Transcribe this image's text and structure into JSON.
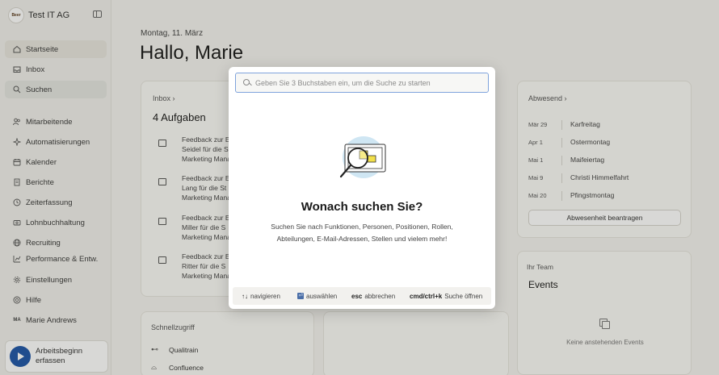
{
  "brand": {
    "name": "Test IT AG",
    "logo_text": "Beer"
  },
  "sidebar": {
    "items": [
      {
        "label": "Startseite"
      },
      {
        "label": "Inbox"
      },
      {
        "label": "Suchen"
      },
      {
        "label": "Mitarbeitende"
      },
      {
        "label": "Automatisierungen"
      },
      {
        "label": "Kalender"
      },
      {
        "label": "Berichte"
      },
      {
        "label": "Zeiterfassung"
      },
      {
        "label": "Lohnbuchhaltung"
      },
      {
        "label": "Recruiting"
      },
      {
        "label": "Performance & Entw."
      },
      {
        "label": "Einstellungen"
      },
      {
        "label": "Hilfe"
      },
      {
        "label": "Marie Andrews",
        "initials": "MA"
      }
    ],
    "cta_line1": "Arbeitsbeginn",
    "cta_line2": "erfassen"
  },
  "main": {
    "date": "Montag, 11. März",
    "greeting": "Hallo, Marie",
    "inbox": {
      "heading": "Inbox  ›",
      "count": "4 Aufgaben",
      "tasks": [
        {
          "l1": "Feedback zur E",
          "l2": "Seidel für die S",
          "l3": "Marketing Mana"
        },
        {
          "l1": "Feedback zur E",
          "l2": "Lang für die St",
          "l3": "Marketing Mana"
        },
        {
          "l1": "Feedback zur E",
          "l2": "Miller für die S",
          "l3": "Marketing Mana"
        },
        {
          "l1": "Feedback zur E",
          "l2": "Ritter für die S",
          "l3": "Marketing Mana"
        }
      ]
    },
    "absences": {
      "heading": "Abwesend  ›",
      "rows": [
        {
          "date": "Mär 29",
          "name": "Karfreitag"
        },
        {
          "date": "Apr 1",
          "name": "Ostermontag"
        },
        {
          "date": "Mai 1",
          "name": "Maifeiertag"
        },
        {
          "date": "Mai 9",
          "name": "Christi Himmelfahrt"
        },
        {
          "date": "Mai 20",
          "name": "Pfingstmontag"
        }
      ],
      "button": "Abwesenheit beantragen"
    },
    "team": {
      "heading": "Ihr Team",
      "events_title": "Events",
      "empty": "Keine anstehenden Events"
    },
    "quick": {
      "heading": "Schnellzugriff",
      "items": [
        {
          "label": "Qualitrain"
        },
        {
          "label": "Confluence"
        }
      ]
    }
  },
  "search_modal": {
    "placeholder": "Geben Sie 3 Buchstaben ein, um die Suche zu starten",
    "title": "Wonach suchen Sie?",
    "description": "Suchen Sie nach Funktionen, Personen, Positionen, Rollen, Abteilungen, E-Mail-Adressen, Stellen und vielem mehr!",
    "hints": [
      {
        "key": "↑↓",
        "label": "navigieren"
      },
      {
        "key": "⏎",
        "label": "auswählen"
      },
      {
        "key": "esc",
        "label": "abbrechen"
      },
      {
        "key": "cmd/ctrl+k",
        "label": "Suche öffnen"
      }
    ]
  },
  "colors": {
    "accent": "#1f56a8",
    "focus_border": "#7fa3dc",
    "illustration_blue": "#cfe6f3",
    "illustration_yellow": "#f2e04a"
  }
}
